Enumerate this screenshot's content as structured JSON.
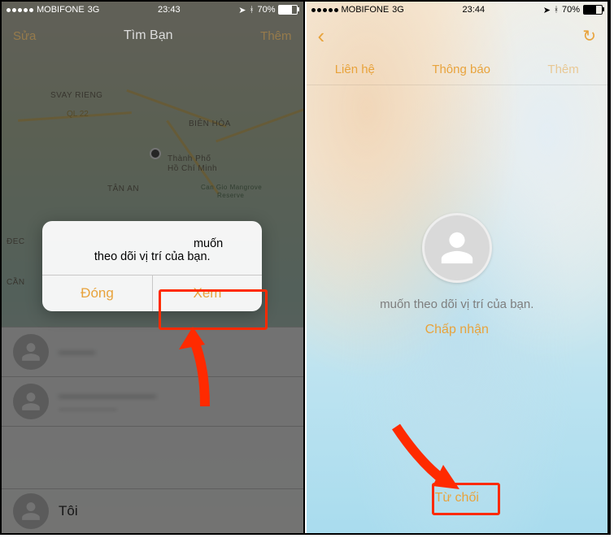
{
  "status": {
    "carrier": "MOBIFONE",
    "network": "3G",
    "time": "23:43",
    "time_right": "23:44",
    "battery": "70%"
  },
  "left": {
    "nav_edit": "Sửa",
    "nav_title": "Tìm Bạn",
    "nav_add": "Thêm",
    "map_labels": {
      "ql22": "QL 22",
      "bienhoa": "Biên Hòa",
      "hcmc_l1": "Thành Phố",
      "hcmc_l2": "Hồ Chí Minh",
      "tanan": "Tân An",
      "svay": "Svay Rieng",
      "dec": "Đec",
      "can": "Cần",
      "mangrove_l1": "Can Gio Mangrove",
      "mangrove_l2": "Reserve"
    },
    "alert_line1": "muốn",
    "alert_line2": "theo dõi vị trí của bạn.",
    "alert_close": "Đóng",
    "alert_view": "Xem",
    "row_self": "Tôi"
  },
  "right": {
    "tabs": {
      "contacts": "Liên hệ",
      "notifications": "Thông báo",
      "more": "Thêm"
    },
    "request_text": "muốn theo dõi vị trí của bạn.",
    "accept": "Chấp nhận",
    "decline": "Từ chối"
  }
}
